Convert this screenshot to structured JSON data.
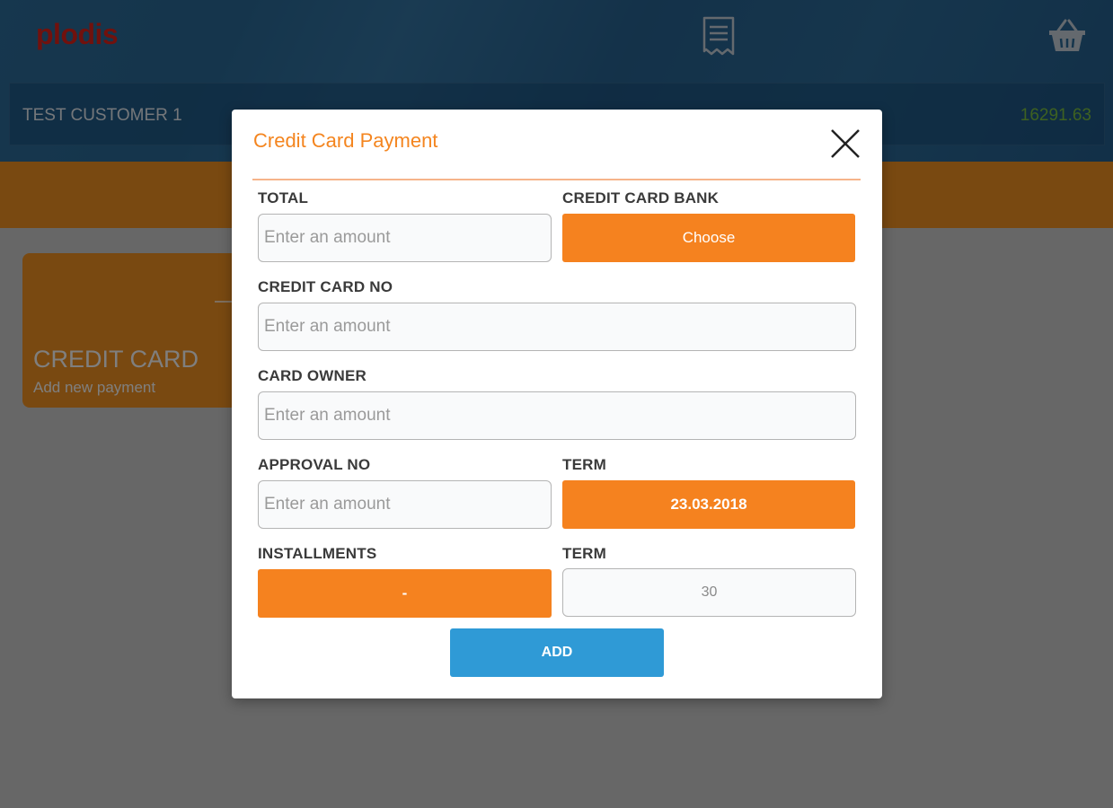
{
  "app": {
    "logo": "plodis",
    "customer_name": "TEST CUSTOMER 1",
    "customer_balance": "16291.63",
    "payment_card": {
      "title": "CREDIT CARD",
      "subtitle": "Add new payment"
    }
  },
  "modal": {
    "title": "Credit Card Payment",
    "fields": {
      "total": {
        "label": "TOTAL",
        "placeholder": "Enter an amount",
        "value": ""
      },
      "bank": {
        "label": "CREDIT CARD BANK",
        "value": "Choose"
      },
      "card_no": {
        "label": "CREDIT CARD NO",
        "placeholder": "Enter an amount",
        "value": ""
      },
      "card_owner": {
        "label": "CARD OWNER",
        "placeholder": "Enter an amount",
        "value": ""
      },
      "approval_no": {
        "label": "APPROVAL NO",
        "placeholder": "Enter an amount",
        "value": ""
      },
      "term_date": {
        "label": "TERM",
        "value": "23.03.2018"
      },
      "installments": {
        "label": "INSTALLMENTS",
        "value": "-"
      },
      "term_days": {
        "label": "TERM",
        "value": "30"
      }
    },
    "add_label": "ADD"
  },
  "colors": {
    "accent_orange": "#f5821f",
    "title_orange": "#f4851f",
    "add_blue": "#2f9ad6",
    "balance_green": "#7cc242",
    "logo_red": "#e2231a"
  },
  "icons": [
    "receipt-icon",
    "basket-icon",
    "close-icon"
  ]
}
